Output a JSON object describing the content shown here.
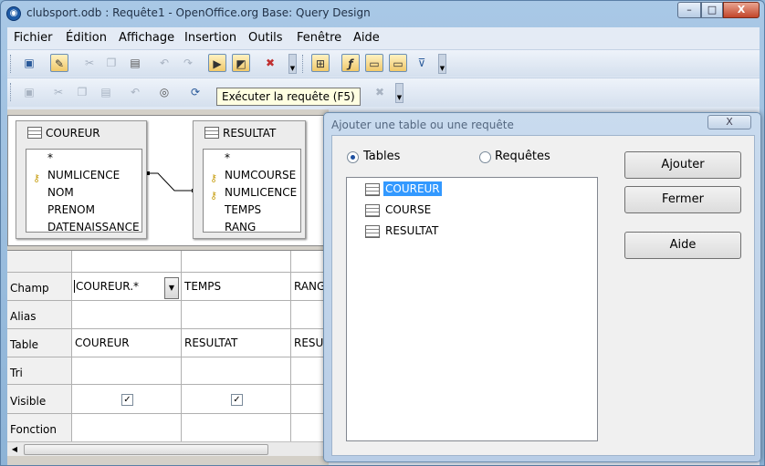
{
  "window": {
    "title": "clubsport.odb : Requête1 - OpenOffice.org Base: Query Design",
    "app_icon": "openoffice-icon",
    "minimize": "–",
    "maximize": "□",
    "close": "X"
  },
  "menu": [
    "Fichier",
    "Édition",
    "Affichage",
    "Insertion",
    "Outils",
    "Fenêtre",
    "Aide"
  ],
  "tooltip": "Exécuter la requête (F5)",
  "tables": [
    {
      "name": "COUREUR",
      "fields": [
        {
          "name": "*",
          "key": false
        },
        {
          "name": "NUMLICENCE",
          "key": true
        },
        {
          "name": "NOM",
          "key": false
        },
        {
          "name": "PRENOM",
          "key": false
        },
        {
          "name": "DATENAISSANCE",
          "key": false
        }
      ]
    },
    {
      "name": "RESULTAT",
      "fields": [
        {
          "name": "*",
          "key": false
        },
        {
          "name": "NUMCOURSE",
          "key": true
        },
        {
          "name": "NUMLICENCE",
          "key": true
        },
        {
          "name": "TEMPS",
          "key": false
        },
        {
          "name": "RANG",
          "key": false
        }
      ]
    }
  ],
  "grid": {
    "row_labels": [
      "Champ",
      "Alias",
      "Table",
      "Tri",
      "Visible",
      "Fonction"
    ],
    "columns": [
      {
        "champ": "COUREUR.*",
        "table": "COUREUR",
        "visible": true
      },
      {
        "champ": "TEMPS",
        "table": "RESULTAT",
        "visible": true
      },
      {
        "champ": "RANG",
        "table": "RESULTAT",
        "visible": false
      }
    ]
  },
  "dialog": {
    "title": "Ajouter une table ou une requête",
    "close": "X",
    "radio_tables": "Tables",
    "radio_queries": "Requêtes",
    "items": [
      "COUREUR",
      "COURSE",
      "RESULTAT"
    ],
    "selected": "COUREUR",
    "btn_add": "Ajouter",
    "btn_close": "Fermer",
    "btn_help": "Aide"
  }
}
